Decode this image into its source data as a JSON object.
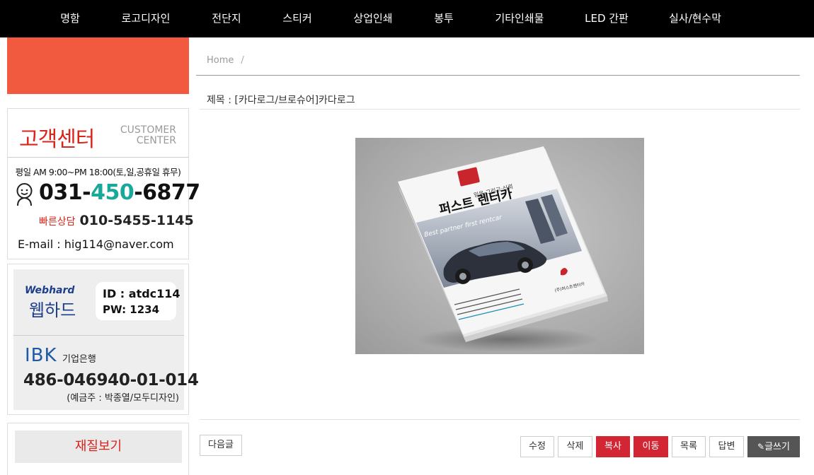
{
  "nav": {
    "items": [
      "명함",
      "로고디자인",
      "전단지",
      "스티커",
      "상업인쇄",
      "봉투",
      "기타인쇄물",
      "LED 간판",
      "실사/현수막"
    ]
  },
  "customer_center": {
    "title": "고객센터",
    "title_en_line1": "CUSTOMER",
    "title_en_line2": "CENTER",
    "hours": "평일 AM 9:00~PM 18:00(토,일,공휴일 휴무)",
    "phone_prefix": "031-",
    "phone_mid": "450",
    "phone_suffix": "-6877",
    "quick_label": "빠른상담",
    "quick_number": "010-5455-1145",
    "email": "E-mail : hig114@naver.com"
  },
  "webhard": {
    "logo": "Webhard",
    "label_kr": "웹하드",
    "id": "ID : atdc114",
    "pw": "PW: 1234"
  },
  "bank": {
    "logo": "IBK",
    "name": "기업은행",
    "account": "486-046940-01-014",
    "holder": "(예금주 : 박종열/모두디자인)"
  },
  "material_button": "재질보기",
  "breadcrumb": {
    "home": "Home",
    "sep": "/"
  },
  "post": {
    "title": "제목 : [카다로그/브로슈어]카다로그",
    "image": {
      "subtitle": "믿음·그리고·신뢰",
      "brand": "퍼스트 렌터카",
      "tagline": "Best partner first rentcar",
      "footer_brand": "(주)퍼스트렌터카"
    }
  },
  "buttons": {
    "next": "다음글",
    "edit": "수정",
    "delete": "삭제",
    "copy": "복사",
    "move": "이동",
    "list": "목록",
    "reply": "답변",
    "write": "글쓰기"
  },
  "colors": {
    "accent_red": "#d32634",
    "banner_red": "#f15a3f",
    "phone_teal": "#1aa89a",
    "nav_bg": "#000000"
  }
}
